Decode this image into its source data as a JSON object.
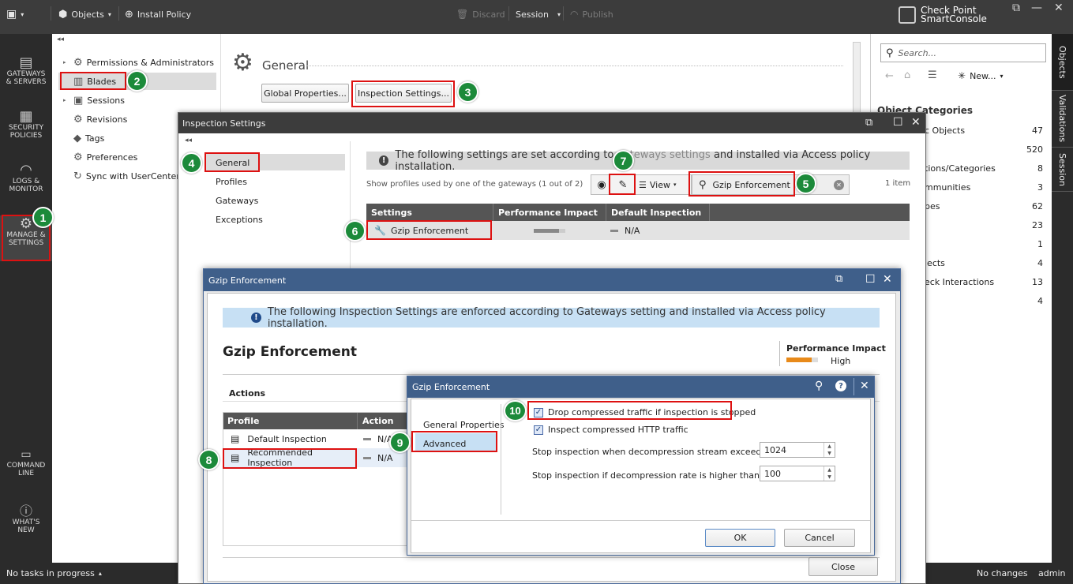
{
  "topbar": {
    "objects": "Objects",
    "install_policy": "Install Policy",
    "discard": "Discard",
    "session": "Session",
    "publish": "Publish",
    "brand_top": "Check Point",
    "brand_bottom": "SmartConsole"
  },
  "leftnav": {
    "items": [
      {
        "label1": "GATEWAYS",
        "label2": "& SERVERS"
      },
      {
        "label1": "SECURITY",
        "label2": "POLICIES"
      },
      {
        "label1": "LOGS &",
        "label2": "MONITOR"
      },
      {
        "label1": "MANAGE &",
        "label2": "SETTINGS"
      },
      {
        "label1": "COMMAND",
        "label2": "LINE"
      },
      {
        "label1": "WHAT'S",
        "label2": "NEW"
      }
    ]
  },
  "tree": {
    "items": [
      "Permissions & Administrators",
      "Blades",
      "Sessions",
      "Revisions",
      "Tags",
      "Preferences",
      "Sync with UserCenter"
    ]
  },
  "general": {
    "title": "General",
    "global_properties": "Global Properties...",
    "inspection_settings": "Inspection Settings..."
  },
  "objpanel": {
    "search_placeholder": "Search...",
    "new_label": "New...",
    "categories_title": "Object Categories",
    "rows": [
      {
        "label": "c Objects",
        "count": "47"
      },
      {
        "label": "",
        "count": "520"
      },
      {
        "label": "tions/Categories",
        "count": "8"
      },
      {
        "label": "mmunities",
        "count": "3"
      },
      {
        "label": "pes",
        "count": "62"
      },
      {
        "label": "",
        "count": "23"
      },
      {
        "label": "",
        "count": "1"
      },
      {
        "label": "jects",
        "count": "4"
      },
      {
        "label": "eck Interactions",
        "count": "13"
      },
      {
        "label": "",
        "count": "4"
      }
    ],
    "tabs": [
      "Objects",
      "Validations",
      "Session"
    ]
  },
  "inspection": {
    "title": "Inspection Settings",
    "nav": [
      "General",
      "Profiles",
      "Gateways",
      "Exceptions"
    ],
    "info_prefix": "The following settings are set according to ",
    "info_link": "gateways settings",
    "info_suffix": " and installed via Access policy installation.",
    "show_profiles": "Show profiles used by one of the gateways (1 out of 2)",
    "view_label": "View",
    "search_value": "Gzip Enforcement",
    "item_count": "1 item",
    "columns": [
      "Settings",
      "Performance Impact",
      "Default Inspection"
    ],
    "row": {
      "setting": "Gzip Enforcement",
      "default": "N/A"
    }
  },
  "gzip": {
    "title": "Gzip Enforcement",
    "info": "The following Inspection Settings are enforced according to Gateways setting and installed via Access policy installation.",
    "heading": "Gzip Enforcement",
    "perf_label": "Performance Impact",
    "perf_value": "High",
    "perf_fraction": 0.8,
    "actions": "Actions",
    "columns": [
      "Profile",
      "Action"
    ],
    "rows": [
      {
        "profile": "Default Inspection",
        "action": "N/A"
      },
      {
        "profile": "Recommended Inspection",
        "action": "N/A"
      }
    ],
    "close": "Close"
  },
  "gzip2": {
    "title": "Gzip Enforcement",
    "nav": [
      "General Properties",
      "Advanced"
    ],
    "drop_label": "Drop compressed traffic if inspection is stopped",
    "inspect_label": "Inspect compressed HTTP traffic",
    "stream_label": "Stop inspection when decompression stream exceeds (KB):",
    "stream_value": "1024",
    "rate_label": "Stop inspection if decompression rate is higher than:",
    "rate_value": "100",
    "ok": "OK",
    "cancel": "Cancel"
  },
  "statusbar": {
    "tasks": "No tasks in progress",
    "changes": "No changes",
    "user": "admin"
  },
  "callouts": [
    "1",
    "2",
    "3",
    "4",
    "5",
    "6",
    "7",
    "8",
    "9",
    "10"
  ]
}
